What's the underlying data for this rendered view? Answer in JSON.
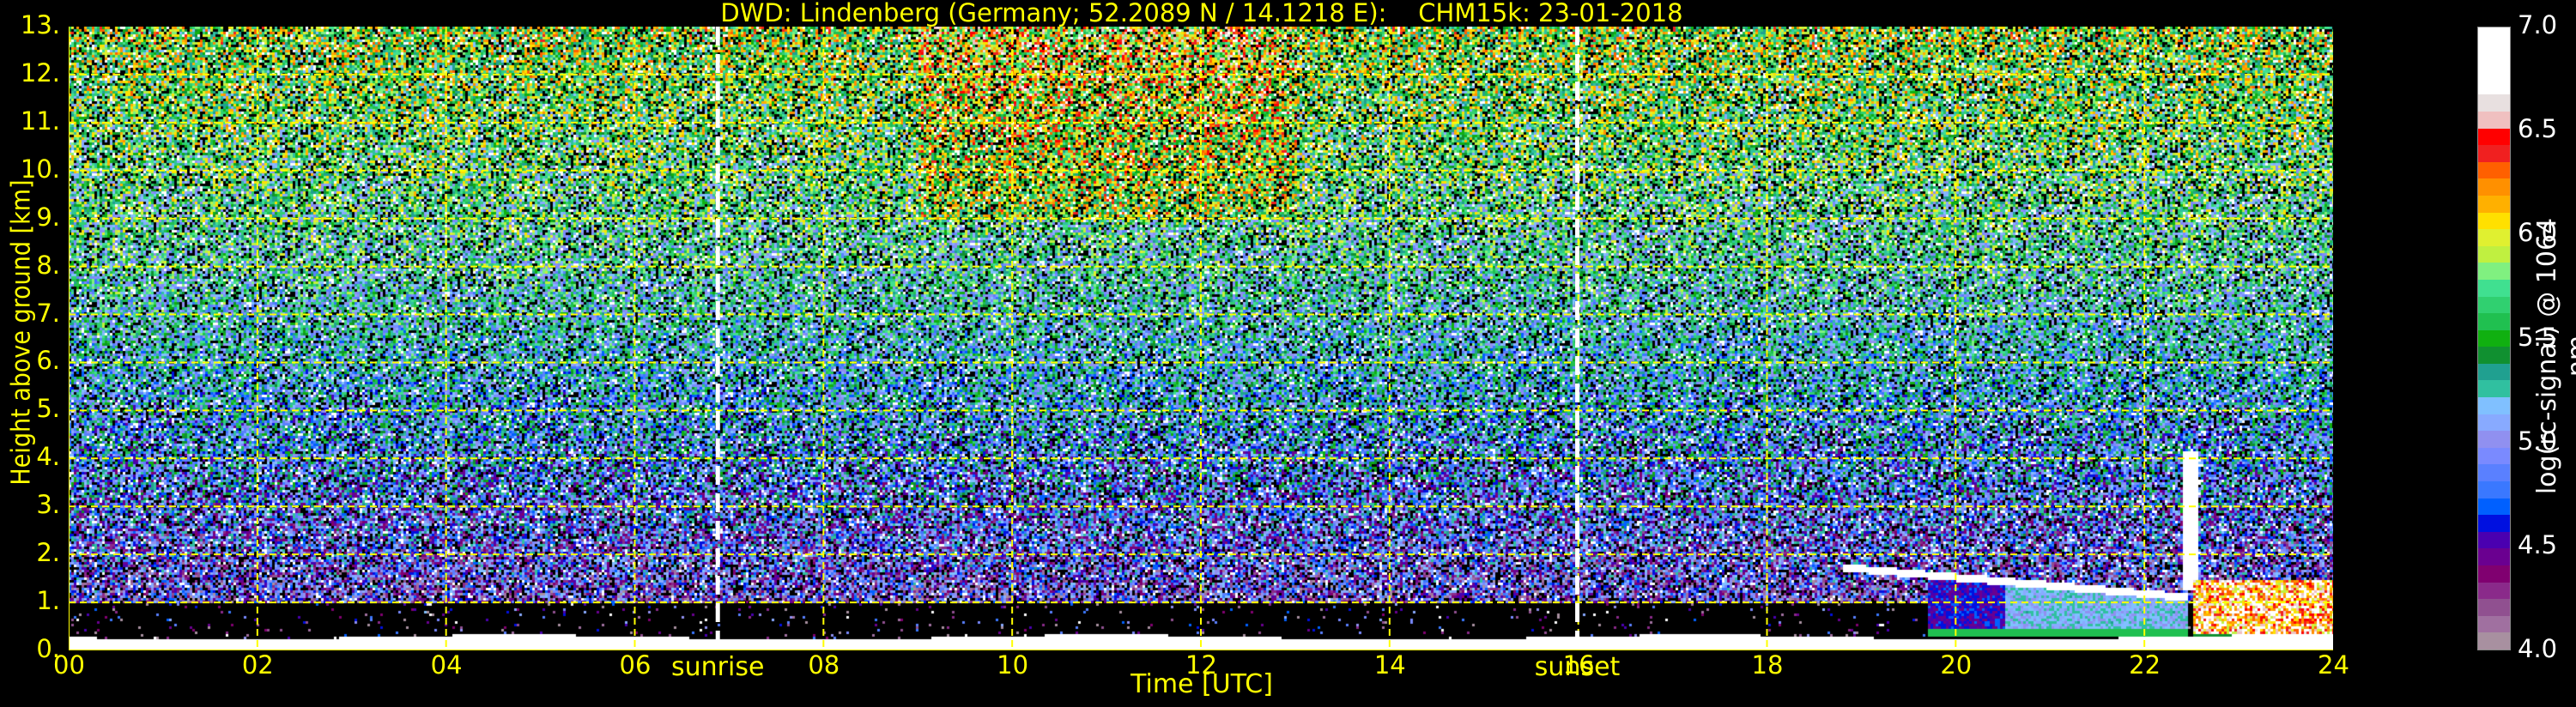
{
  "title": "DWD: Lindenberg (Germany; 52.2089 N / 14.1218 E):    CHM15k: 23-01-2018",
  "chart_data": {
    "type": "heatmap",
    "title": "DWD: Lindenberg (Germany; 52.2089 N / 14.1218 E):    CHM15k: 23-01-2018",
    "xlabel": "Time [UTC]",
    "ylabel": "Height above ground [km]",
    "xlim": [
      0,
      24
    ],
    "ylim": [
      0,
      13
    ],
    "xticks": [
      "00",
      "02",
      "04",
      "06",
      "08",
      "10",
      "12",
      "14",
      "16",
      "18",
      "20",
      "22",
      "24"
    ],
    "yticks": [
      "0.",
      "1.",
      "2.",
      "3.",
      "4.",
      "5.",
      "6.",
      "7.",
      "8.",
      "9.",
      "10.",
      "11.",
      "12.",
      "13."
    ],
    "grid": true,
    "annotations": [
      {
        "label": "sunrise",
        "time_h": 6.88
      },
      {
        "label": "sunset",
        "time_h": 15.99
      }
    ],
    "colorbar": {
      "label": "log(rc-signal) @ 1064 nm",
      "range": [
        4.0,
        7.0
      ],
      "ticks": [
        "4.0",
        "4.5",
        "5.0",
        "5.5",
        "6.0",
        "6.5",
        "7.0"
      ],
      "colors": [
        "#a890a0",
        "#a070a0",
        "#905090",
        "#8a2a8a",
        "#800070",
        "#6a0090",
        "#4a00b0",
        "#0010e0",
        "#0060ff",
        "#3a78ff",
        "#5a80ff",
        "#7a8aff",
        "#9090f0",
        "#88aaff",
        "#80c0ff",
        "#30c0a0",
        "#20a090",
        "#109030",
        "#10b010",
        "#20c050",
        "#30d070",
        "#40e090",
        "#80f080",
        "#c0f040",
        "#e0f030",
        "#ffe000",
        "#ffb000",
        "#ff9000",
        "#ff6000",
        "#f02020",
        "#ff0000",
        "#f0c0c0",
        "#e8e0e0",
        "#ffffff",
        "#ffffff",
        "#ffffff",
        "#ffffff"
      ]
    }
  }
}
